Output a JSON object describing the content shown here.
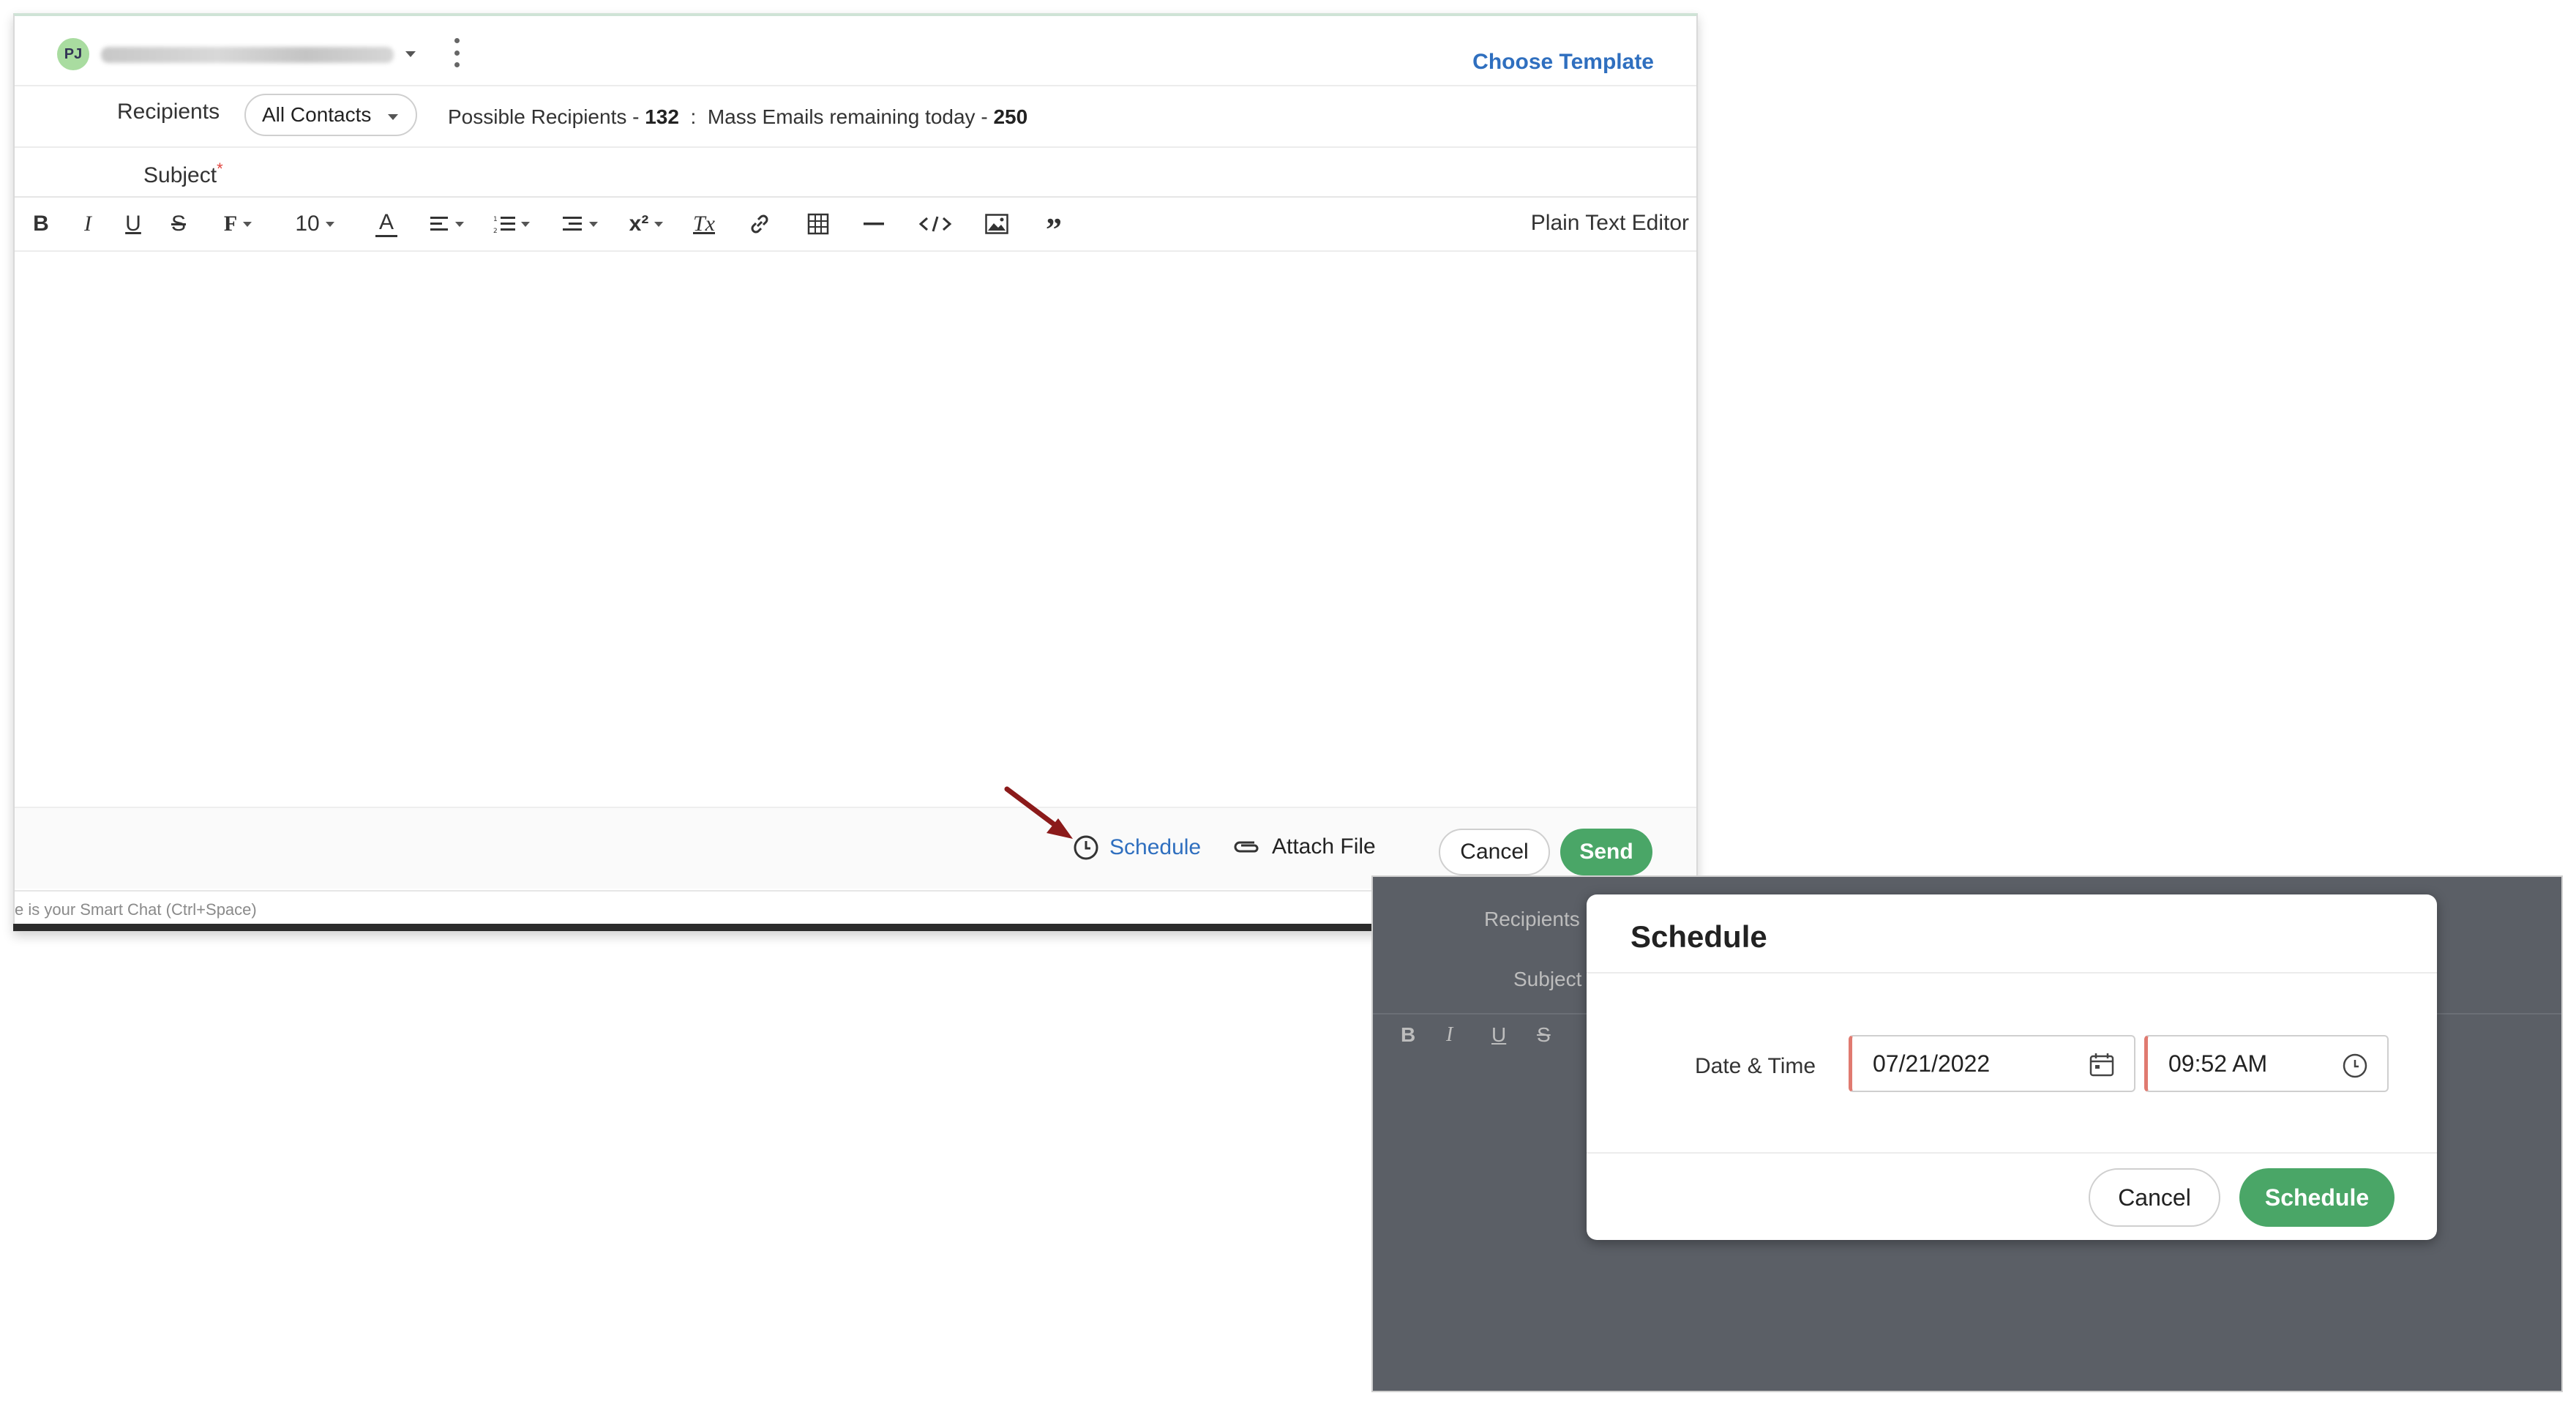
{
  "composer": {
    "avatar_initials": "PJ",
    "choose_template": "Choose Template",
    "recipients_label": "Recipients",
    "recipients_selected": "All Contacts",
    "possible_recipients_label": "Possible Recipients",
    "possible_recipients_count": "132",
    "mass_emails_label": "Mass Emails remaining today",
    "mass_emails_count": "250",
    "subject_label": "Subject",
    "subject_required_mark": "*",
    "toolbar": {
      "bold": "B",
      "italic": "I",
      "underline": "U",
      "strike": "S",
      "font": "F",
      "font_size": "10",
      "font_color": "A",
      "superscript": "x²",
      "clear_format": "Tx",
      "plain_text_editor": "Plain Text Editor"
    },
    "footer": {
      "schedule": "Schedule",
      "attach_file": "Attach File",
      "cancel": "Cancel",
      "send": "Send"
    },
    "smart_chat_hint": "e is your Smart Chat (Ctrl+Space)"
  },
  "overlay": {
    "ghost_recipients": "Recipients",
    "ghost_subject": "Subject",
    "ghost_bold": "B",
    "ghost_italic": "I",
    "ghost_underline": "U",
    "ghost_strike": "S"
  },
  "dialog": {
    "title": "Schedule",
    "date_time_label": "Date & Time",
    "date_value": "07/21/2022",
    "time_value": "09:52 AM",
    "cancel": "Cancel",
    "schedule": "Schedule"
  },
  "colors": {
    "accent_blue": "#2f6fbf",
    "send_green": "#4aa667",
    "required_red": "#e0443e",
    "arrow_red": "#8b1a1a",
    "overlay_gray": "#5b5f66"
  }
}
